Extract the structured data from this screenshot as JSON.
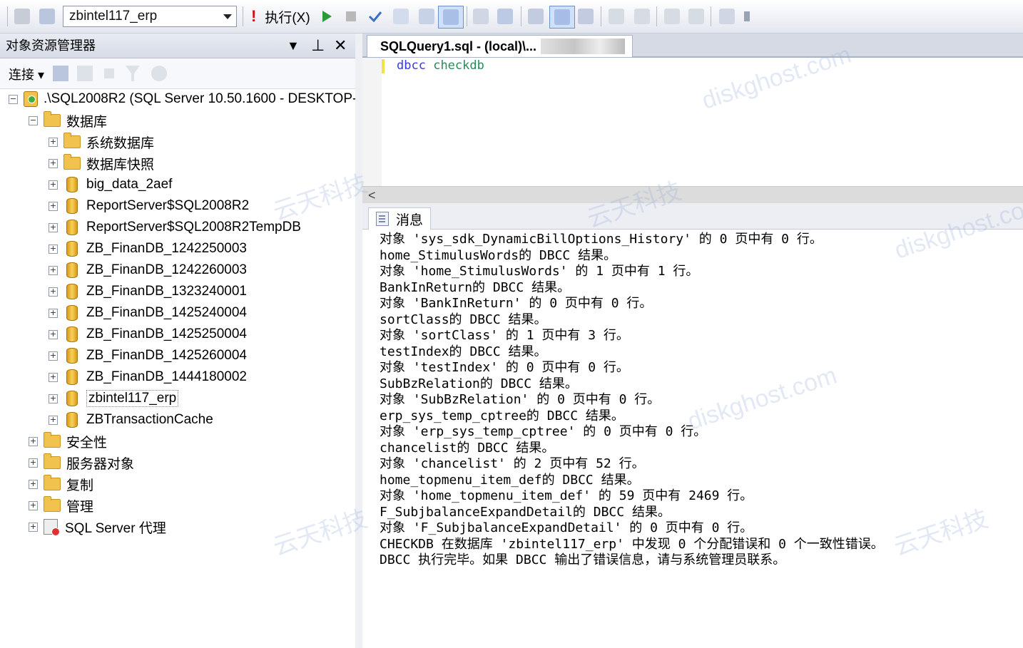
{
  "toolbar": {
    "database": "zbintel117_erp",
    "execute_label": "执行(X)"
  },
  "object_explorer": {
    "title": "对象资源管理器",
    "pin_glyph": "⊥",
    "close_glyph": "✕",
    "connect_label": "连接",
    "tree": [
      {
        "level": 0,
        "label": ".\\SQL2008R2 (SQL Server 10.50.1600 - DESKTOP-",
        "icon": "server-icon",
        "expanded": true
      },
      {
        "level": 1,
        "label": "数据库",
        "icon": "folder-icon",
        "expanded": true
      },
      {
        "level": 2,
        "label": "系统数据库",
        "icon": "folder-icon"
      },
      {
        "level": 2,
        "label": "数据库快照",
        "icon": "folder-icon"
      },
      {
        "level": 2,
        "label": "big_data_2aef",
        "icon": "database-icon"
      },
      {
        "level": 2,
        "label": "ReportServer$SQL2008R2",
        "icon": "database-icon"
      },
      {
        "level": 2,
        "label": "ReportServer$SQL2008R2TempDB",
        "icon": "database-icon"
      },
      {
        "level": 2,
        "label": "ZB_FinanDB_1242250003",
        "icon": "database-icon"
      },
      {
        "level": 2,
        "label": "ZB_FinanDB_1242260003",
        "icon": "database-icon"
      },
      {
        "level": 2,
        "label": "ZB_FinanDB_1323240001",
        "icon": "database-icon"
      },
      {
        "level": 2,
        "label": "ZB_FinanDB_1425240004",
        "icon": "database-icon"
      },
      {
        "level": 2,
        "label": "ZB_FinanDB_1425250004",
        "icon": "database-icon"
      },
      {
        "level": 2,
        "label": "ZB_FinanDB_1425260004",
        "icon": "database-icon"
      },
      {
        "level": 2,
        "label": "ZB_FinanDB_1444180002",
        "icon": "database-icon"
      },
      {
        "level": 2,
        "label": "zbintel117_erp",
        "icon": "database-icon",
        "selected": true
      },
      {
        "level": 2,
        "label": "ZBTransactionCache",
        "icon": "database-icon"
      },
      {
        "level": 1,
        "label": "安全性",
        "icon": "folder-icon"
      },
      {
        "level": 1,
        "label": "服务器对象",
        "icon": "folder-icon"
      },
      {
        "level": 1,
        "label": "复制",
        "icon": "folder-icon"
      },
      {
        "level": 1,
        "label": "管理",
        "icon": "folder-icon"
      },
      {
        "level": 1,
        "label": "SQL Server 代理",
        "icon": "agent-icon"
      }
    ]
  },
  "editor": {
    "tab_title": "SQLQuery1.sql - (local)\\...",
    "code_keyword1": "dbcc",
    "code_keyword2": "checkdb"
  },
  "results": {
    "tab_label": "消息",
    "messages": [
      "对象 'sys_sdk_DynamicBillOptions_History' 的 0 页中有 0 行。",
      "home_StimulusWords的 DBCC 结果。",
      "对象 'home_StimulusWords' 的 1 页中有 1 行。",
      "BankInReturn的 DBCC 结果。",
      "对象 'BankInReturn' 的 0 页中有 0 行。",
      "sortClass的 DBCC 结果。",
      "对象 'sortClass' 的 1 页中有 3 行。",
      "testIndex的 DBCC 结果。",
      "对象 'testIndex' 的 0 页中有 0 行。",
      "SubBzRelation的 DBCC 结果。",
      "对象 'SubBzRelation' 的 0 页中有 0 行。",
      "erp_sys_temp_cptree的 DBCC 结果。",
      "对象 'erp_sys_temp_cptree' 的 0 页中有 0 行。",
      "chancelist的 DBCC 结果。",
      "对象 'chancelist' 的 2 页中有 52 行。",
      "home_topmenu_item_def的 DBCC 结果。",
      "对象 'home_topmenu_item_def' 的 59 页中有 2469 行。",
      "F_SubjbalanceExpandDetail的 DBCC 结果。",
      "对象 'F_SubjbalanceExpandDetail' 的 0 页中有 0 行。",
      "CHECKDB 在数据库 'zbintel117_erp' 中发现 0 个分配错误和 0 个一致性错误。",
      "DBCC 执行完毕。如果 DBCC 输出了错误信息，请与系统管理员联系。"
    ]
  },
  "watermarks": [
    "云天科技",
    "diskghost.com"
  ],
  "colors": {
    "keyword": "#3a3ad6",
    "keyword2": "#2b8a57",
    "folder": "#f1c24e",
    "database": "#e8b32e"
  }
}
